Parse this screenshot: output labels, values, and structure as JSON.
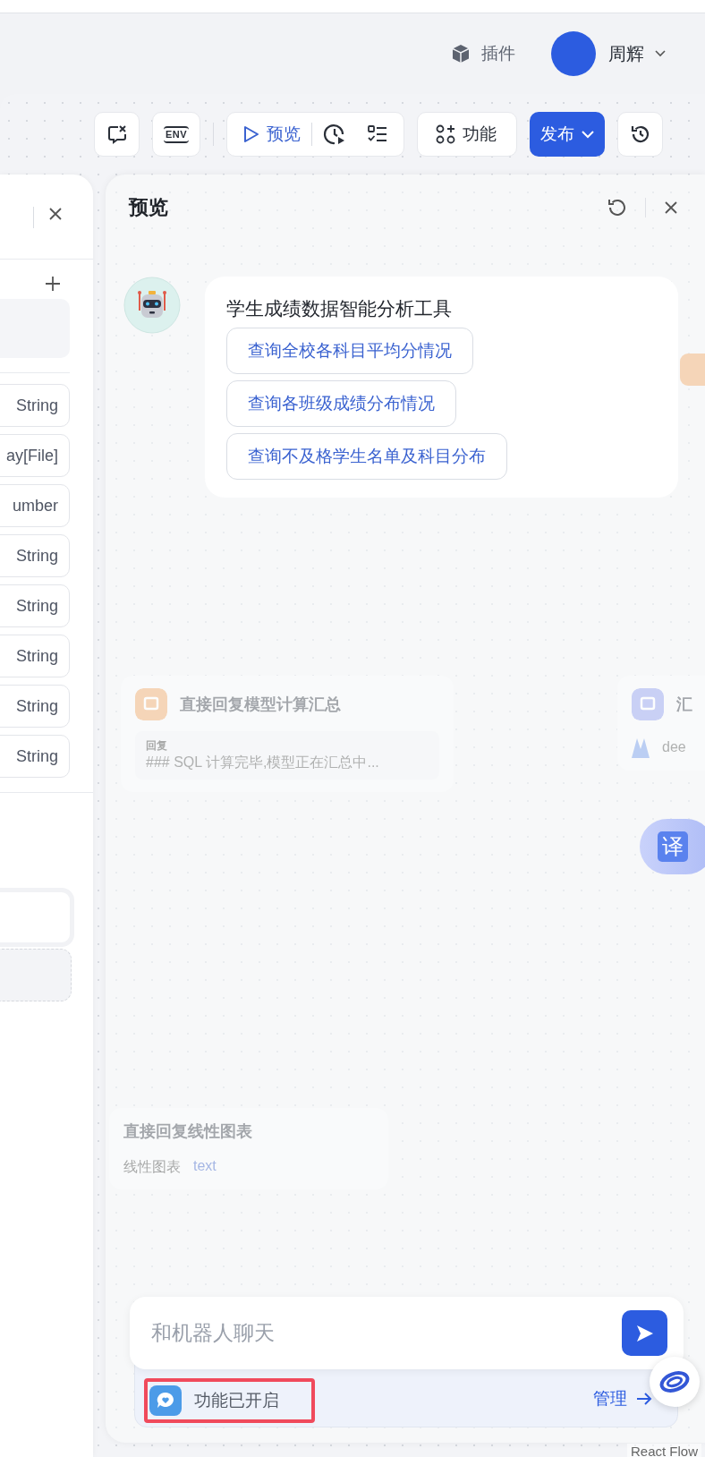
{
  "header": {
    "plugin_label": "插件",
    "user_name": "周辉"
  },
  "toolbar": {
    "env_label": "ENV",
    "preview_label": "预览",
    "feature_label": "功能",
    "publish_label": "发布"
  },
  "left_panel": {
    "type_tags": [
      "String",
      "ay[File]",
      "umber",
      "String",
      "String",
      "String",
      "String",
      "String"
    ]
  },
  "canvas_nodes": [
    {
      "kind": "reply",
      "title": "直接回复模型计算汇总",
      "label": "回复",
      "text": "### SQL 计算完毕,模型正在汇总中..."
    },
    {
      "kind": "llm",
      "title": "汇",
      "model": "dee"
    },
    {
      "kind": "chart",
      "title": "直接回复线性图表",
      "label": "线性图表",
      "var": "text"
    }
  ],
  "preview": {
    "title": "预览",
    "bot_message": {
      "title": "学生成绩数据智能分析工具",
      "suggestions": [
        "查询全校各科目平均分情况",
        "查询各班级成绩分布情况",
        "查询不及格学生名单及科目分布"
      ]
    },
    "input": {
      "placeholder": "和机器人聊天"
    },
    "feature_bar": {
      "status": "功能已开启",
      "manage_label": "管理",
      "highlighted": true
    }
  },
  "translate_button": "译",
  "attribution": "React Flow"
}
